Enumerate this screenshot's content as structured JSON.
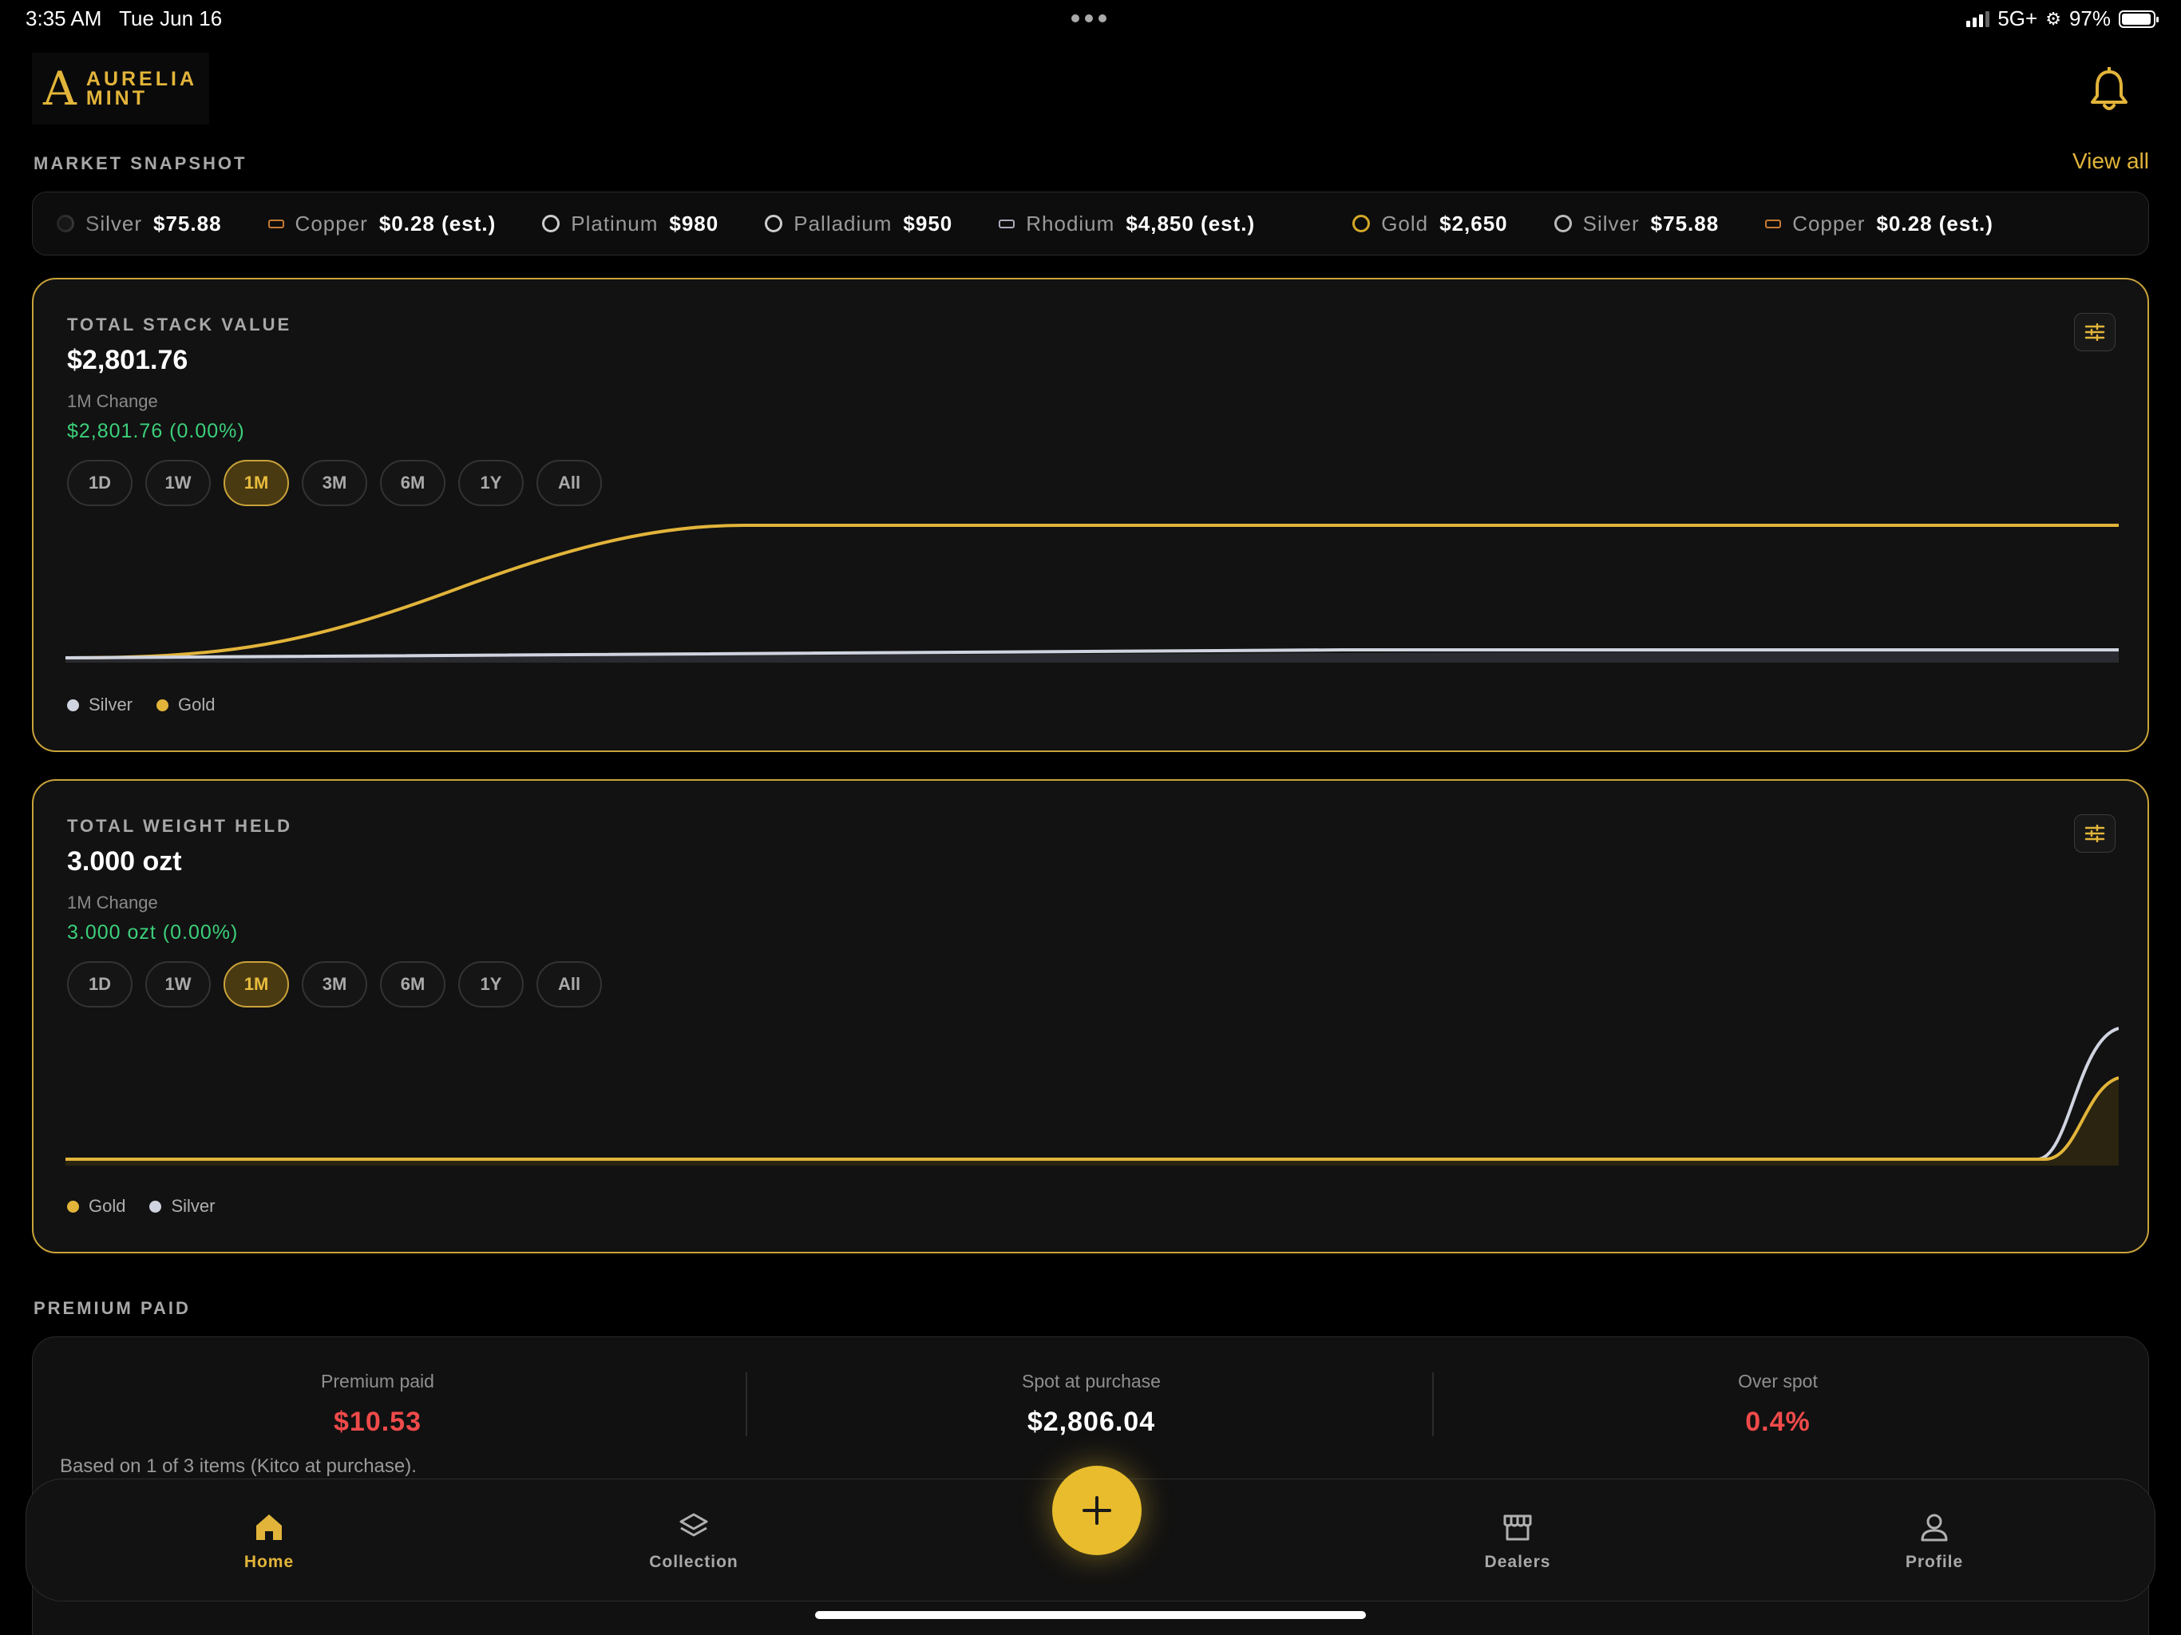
{
  "status": {
    "time": "3:35 AM",
    "date": "Tue Jun 16",
    "network": "5G+",
    "battery": "97%"
  },
  "brand": {
    "line1": "AURELIA",
    "line2": "MINT",
    "mark": "A",
    "accent": "#e2b43a"
  },
  "market": {
    "title": "MARKET SNAPSHOT",
    "view_all": "View all",
    "items": [
      {
        "name": "Silver",
        "price": "$75.88",
        "icon": "ring-icon"
      },
      {
        "name": "Copper",
        "price": "$0.28 (est.)",
        "icon": "bar-icon"
      },
      {
        "name": "Platinum",
        "price": "$980",
        "icon": "ring-icon"
      },
      {
        "name": "Palladium",
        "price": "$950",
        "icon": "ring-icon"
      },
      {
        "name": "Rhodium",
        "price": "$4,850 (est.)",
        "icon": "bar-icon"
      },
      {
        "name": "Gold",
        "price": "$2,650",
        "icon": "ring-icon"
      },
      {
        "name": "Silver",
        "price": "$75.88",
        "icon": "ring-icon"
      },
      {
        "name": "Copper",
        "price": "$0.28 (est.)",
        "icon": "bar-icon"
      }
    ]
  },
  "ranges": [
    "1D",
    "1W",
    "1M",
    "3M",
    "6M",
    "1Y",
    "All"
  ],
  "stack_value": {
    "label": "TOTAL STACK VALUE",
    "value": "$2,801.76",
    "change_label": "1M Change",
    "change": "$2,801.76 (0.00%)",
    "active_range": "1M",
    "legend": [
      {
        "name": "Silver",
        "color": "#d0d4e0"
      },
      {
        "name": "Gold",
        "color": "#e2b43a"
      }
    ]
  },
  "weight_held": {
    "label": "TOTAL WEIGHT HELD",
    "value": "3.000 ozt",
    "change_label": "1M Change",
    "change": "3.000 ozt (0.00%)",
    "active_range": "1M",
    "legend": [
      {
        "name": "Gold",
        "color": "#e2b43a"
      },
      {
        "name": "Silver",
        "color": "#d0d4e0"
      }
    ]
  },
  "premium": {
    "title": "PREMIUM PAID",
    "paid_label": "Premium paid",
    "paid_value": "$10.53",
    "spot_label": "Spot at purchase",
    "spot_value": "$2,806.04",
    "over_label": "Over spot",
    "over_value": "0.4%",
    "note": "Based on 1 of 3 items (Kitco at purchase).",
    "negative_color": "#f04a4a"
  },
  "tabs": [
    {
      "label": "Home",
      "icon": "home-icon"
    },
    {
      "label": "Collection",
      "icon": "layers-icon"
    },
    {
      "label": "Dealers",
      "icon": "store-icon"
    },
    {
      "label": "Profile",
      "icon": "user-icon"
    }
  ]
}
